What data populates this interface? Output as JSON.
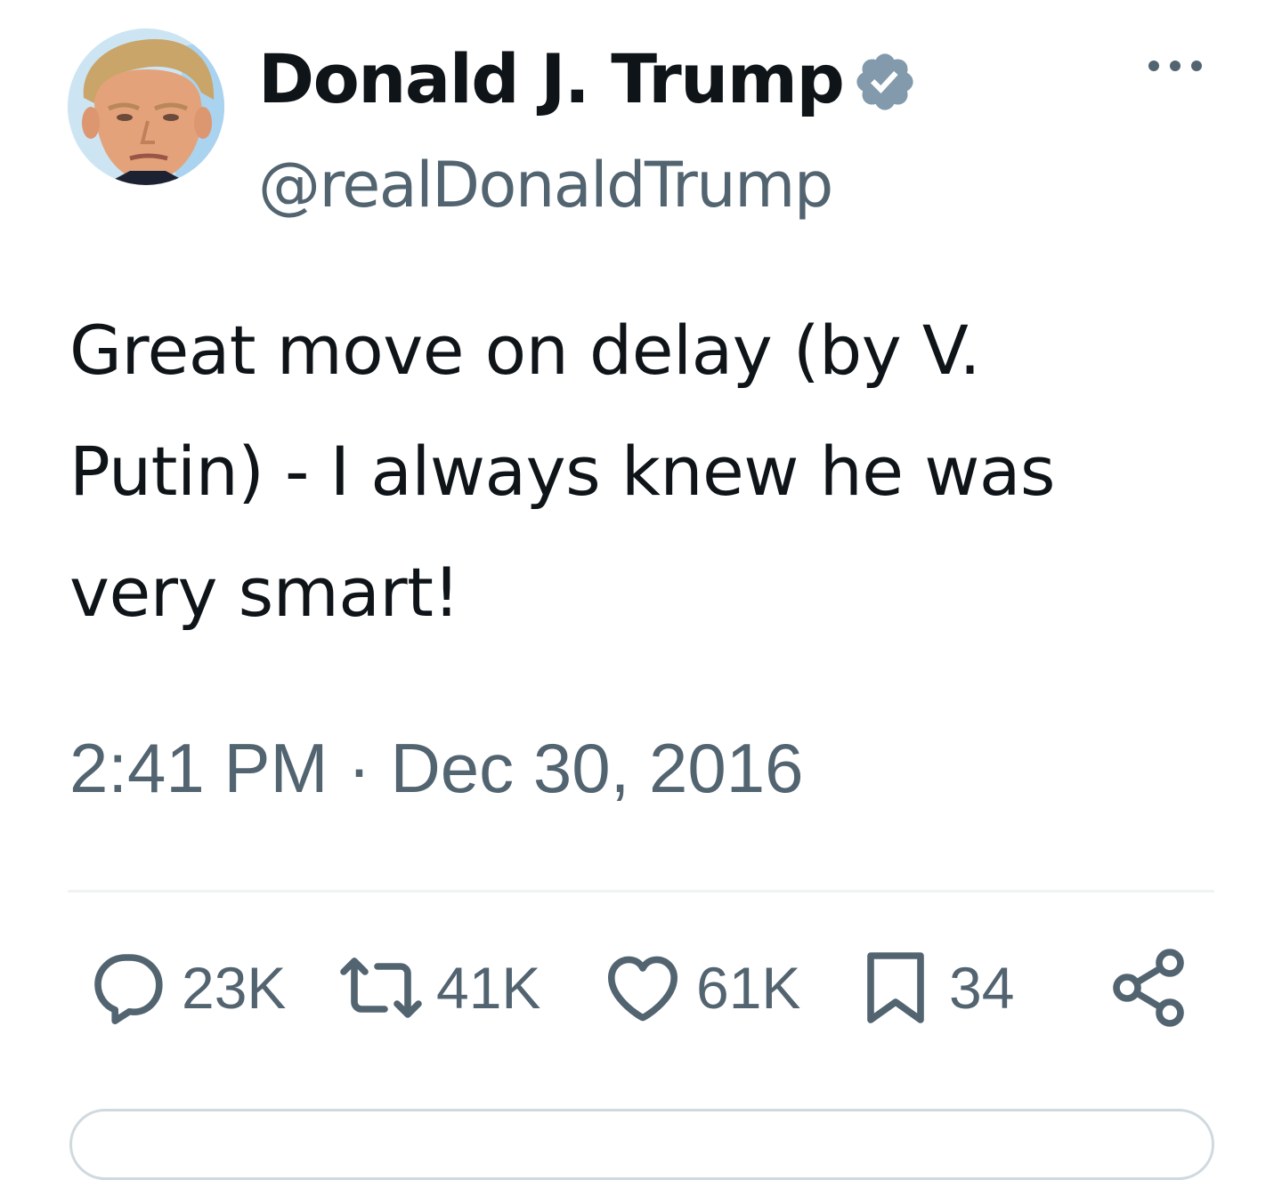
{
  "author": {
    "display_name": "Donald J. Trump",
    "handle": "@realDonaldTrump",
    "verified": true,
    "verified_color": "#829aab"
  },
  "tweet": {
    "text": "Great move on delay (by V. Putin) - I always knew he was very smart!",
    "time": "2:41 PM",
    "separator": "·",
    "date": "Dec 30, 2016"
  },
  "actions": {
    "replies": "23K",
    "reposts": "41K",
    "likes": "61K",
    "bookmarks": "34"
  },
  "icons": [
    "verified-badge-icon",
    "more-icon",
    "reply-icon",
    "repost-icon",
    "like-icon",
    "bookmark-icon",
    "share-icon"
  ],
  "colors": {
    "text_primary": "#0f1419",
    "text_secondary": "#536471",
    "divider": "#eff3f4"
  }
}
